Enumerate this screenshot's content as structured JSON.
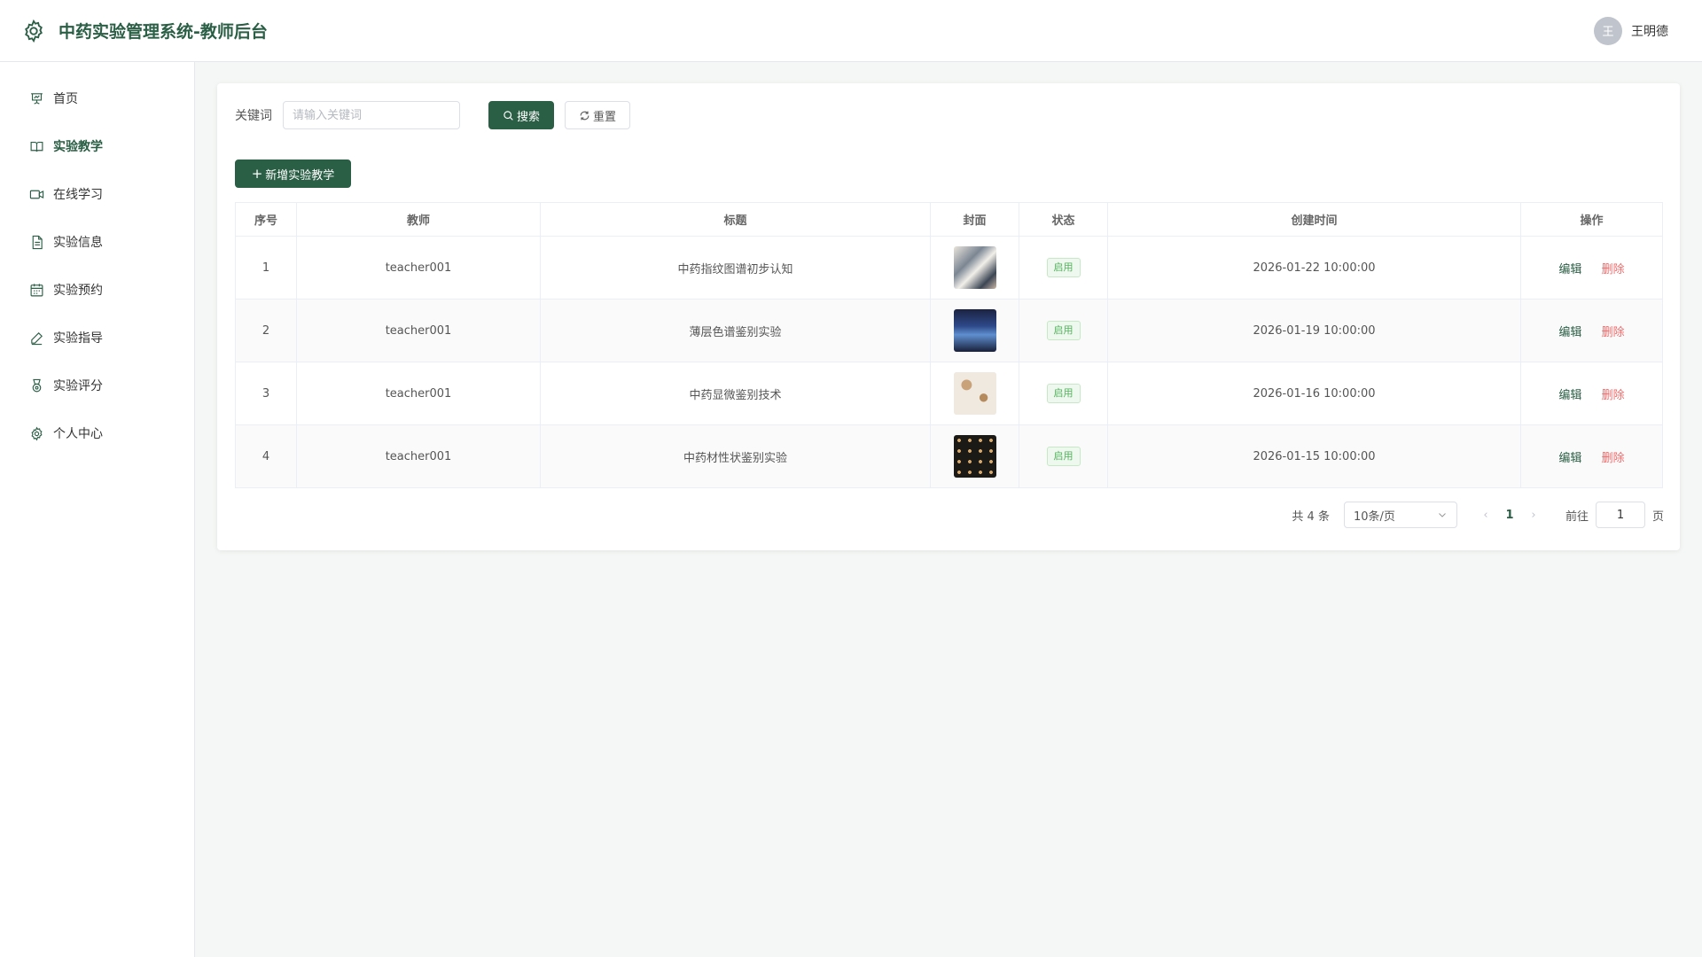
{
  "header": {
    "title": "中药实验管理系统-教师后台",
    "avatar_text": "王",
    "user_name": "王明德"
  },
  "sidebar": {
    "items": [
      {
        "label": "首页",
        "icon": "presentation-icon"
      },
      {
        "label": "实验教学",
        "icon": "book-icon",
        "active": true
      },
      {
        "label": "在线学习",
        "icon": "video-icon"
      },
      {
        "label": "实验信息",
        "icon": "document-icon"
      },
      {
        "label": "实验预约",
        "icon": "calendar-icon"
      },
      {
        "label": "实验指导",
        "icon": "pen-icon"
      },
      {
        "label": "实验评分",
        "icon": "medal-icon"
      },
      {
        "label": "个人中心",
        "icon": "gear-icon"
      }
    ]
  },
  "search": {
    "label": "关键词",
    "placeholder": "请输入关键词",
    "value": "",
    "search_label": "搜索",
    "reset_label": "重置"
  },
  "toolbar": {
    "add_label": "新增实验教学"
  },
  "table": {
    "columns": [
      "序号",
      "教师",
      "标题",
      "封面",
      "状态",
      "创建时间",
      "操作"
    ],
    "rows": [
      {
        "index": "1",
        "teacher": "teacher001",
        "title": "中药指纹图谱初步认知",
        "status": "启用",
        "created": "2026-01-22 10:00:00",
        "edit": "编辑",
        "delete": "删除"
      },
      {
        "index": "2",
        "teacher": "teacher001",
        "title": "薄层色谱鉴别实验",
        "status": "启用",
        "created": "2026-01-19 10:00:00",
        "edit": "编辑",
        "delete": "删除"
      },
      {
        "index": "3",
        "teacher": "teacher001",
        "title": "中药显微鉴别技术",
        "status": "启用",
        "created": "2026-01-16 10:00:00",
        "edit": "编辑",
        "delete": "删除"
      },
      {
        "index": "4",
        "teacher": "teacher001",
        "title": "中药材性状鉴别实验",
        "status": "启用",
        "created": "2026-01-15 10:00:00",
        "edit": "编辑",
        "delete": "删除"
      }
    ]
  },
  "pagination": {
    "total_text": "共 4 条",
    "page_size": "10条/页",
    "current_page": "1",
    "goto_label": "前往",
    "goto_value": "1",
    "page_unit": "页"
  },
  "colors": {
    "primary": "#2a5e45",
    "danger": "#f06a6a",
    "status": "#52b35c"
  }
}
